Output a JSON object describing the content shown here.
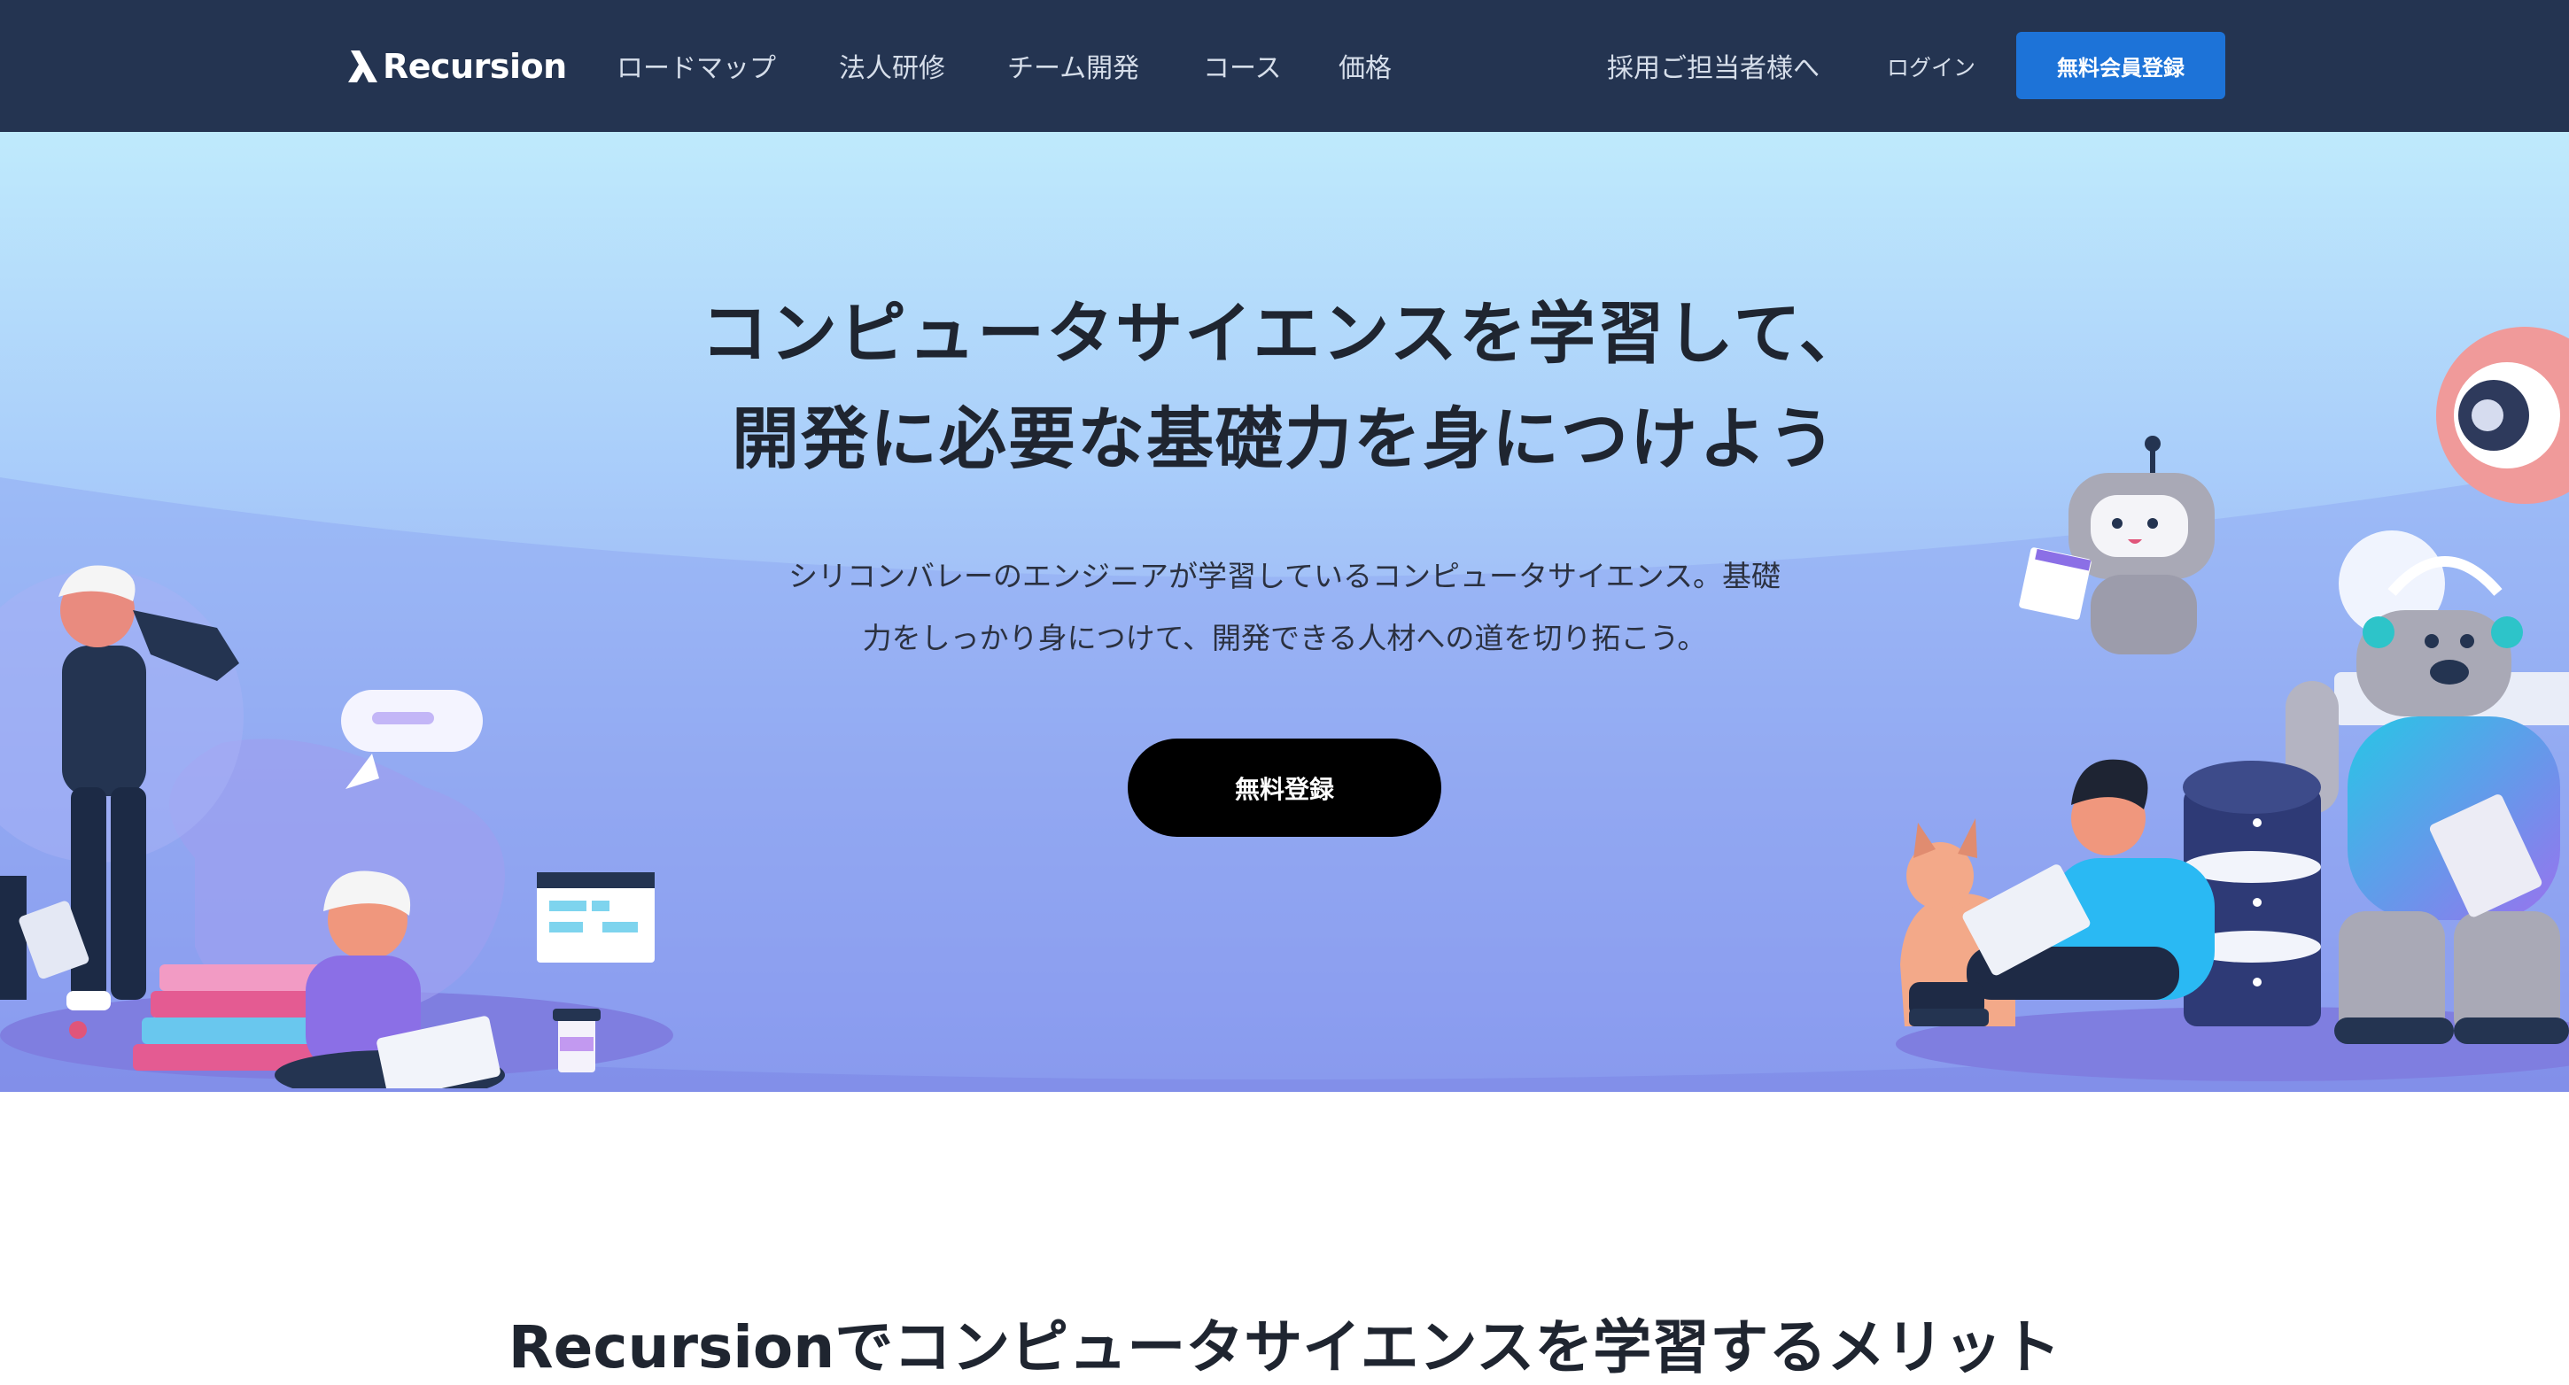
{
  "header": {
    "logo_text": "Recursion",
    "nav": [
      "ロードマップ",
      "法人研修",
      "チーム開発",
      "コース",
      "価格"
    ],
    "recruiter_link": "採用ご担当者様へ",
    "login": "ログイン",
    "signup_button": "無料会員登録"
  },
  "hero": {
    "title_line1": "コンピュータサイエンスを学習して、",
    "title_line2": "開発に必要な基礎力を身につけよう",
    "subtitle_line1": "シリコンバレーのエンジニアが学習しているコンピュータサイエンス。基礎",
    "subtitle_line2": "力をしっかり身につけて、開発できる人材への道を切り拓こう。",
    "cta_button": "無料登録"
  },
  "section": {
    "title": "Recursionでコンピュータサイエンスを学習するメリット"
  },
  "colors": {
    "header_bg": "#243451",
    "accent_blue": "#1d73d8",
    "cta_bg": "#000000"
  }
}
